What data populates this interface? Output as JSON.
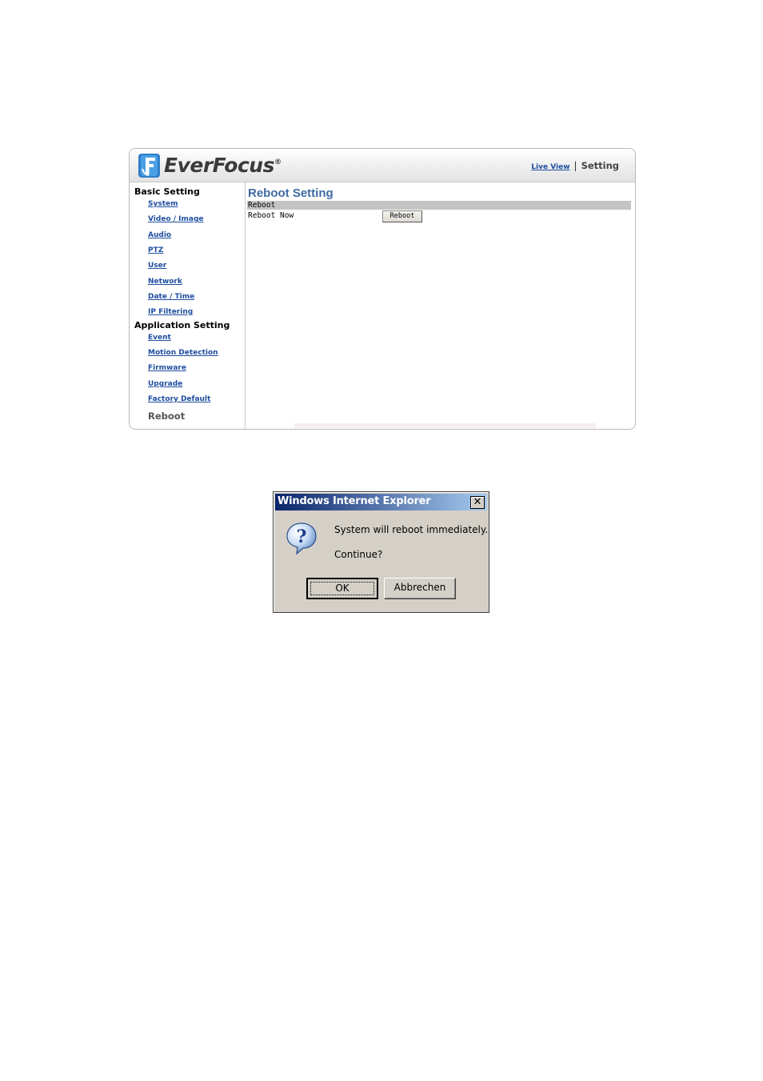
{
  "header": {
    "brand": "EverFocus",
    "brand_mark": "®",
    "nav_live_view": "Live View",
    "nav_separator": "|",
    "nav_current": "Setting"
  },
  "sidebar": {
    "basic_title": "Basic Setting",
    "basic_items": [
      "System",
      "Video / Image",
      "Audio",
      "PTZ",
      "User",
      "Network",
      "Date / Time",
      "IP Filtering"
    ],
    "application_title": "Application Setting",
    "application_items": [
      "Event",
      "Motion Detection",
      "Firmware",
      "Upgrade",
      "Factory Default"
    ],
    "current_item": "Reboot"
  },
  "content": {
    "title": "Reboot Setting",
    "section_header": "Reboot",
    "row_label": "Reboot Now",
    "button_label": "Reboot"
  },
  "dialog": {
    "title": "Windows Internet Explorer",
    "close_glyph": "✕",
    "message_line1": "System will reboot immediately.",
    "message_line2": "Continue?",
    "ok_label": "OK",
    "cancel_label": "Abbrechen",
    "icon": "question-icon"
  },
  "colors": {
    "accent_blue": "#1f4ea0",
    "title_blue": "#3f6aa3",
    "dialog_face": "#d4d0c8",
    "titlebar_start": "#0a246a",
    "titlebar_end": "#a6caf0"
  }
}
